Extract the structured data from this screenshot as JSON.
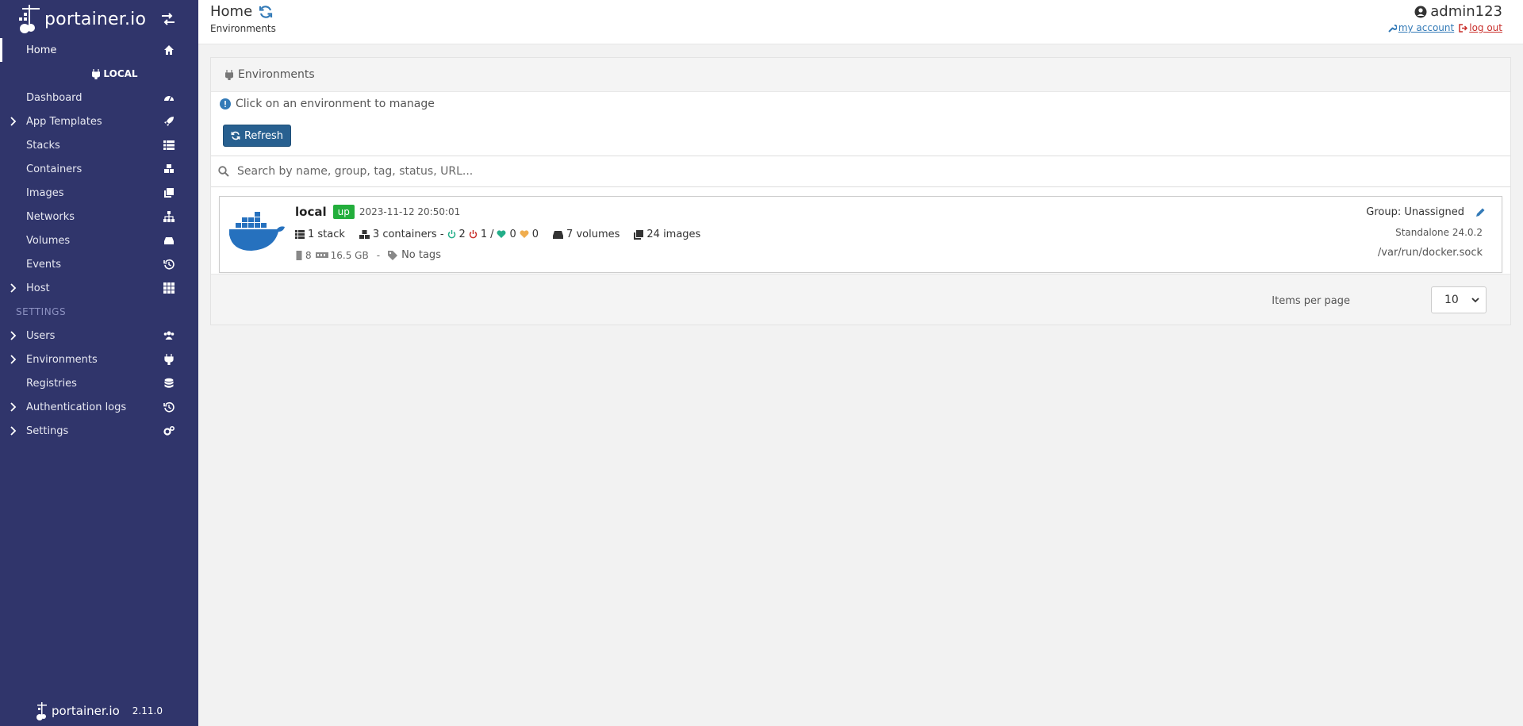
{
  "sidebar": {
    "logo_text": "portainer.io",
    "home_label": "Home",
    "env_label": "LOCAL",
    "items": [
      {
        "label": "Dashboard",
        "icon": "tachometer-icon",
        "chevron": false
      },
      {
        "label": "App Templates",
        "icon": "rocket-icon",
        "chevron": true
      },
      {
        "label": "Stacks",
        "icon": "list-icon",
        "chevron": false
      },
      {
        "label": "Containers",
        "icon": "cubes-icon",
        "chevron": false
      },
      {
        "label": "Images",
        "icon": "clone-icon",
        "chevron": false
      },
      {
        "label": "Networks",
        "icon": "sitemap-icon",
        "chevron": false
      },
      {
        "label": "Volumes",
        "icon": "hdd-icon",
        "chevron": false
      },
      {
        "label": "Events",
        "icon": "history-icon",
        "chevron": false
      },
      {
        "label": "Host",
        "icon": "th-icon",
        "chevron": true
      }
    ],
    "settings_heading": "SETTINGS",
    "settings_items": [
      {
        "label": "Users",
        "icon": "users-icon",
        "chevron": true
      },
      {
        "label": "Environments",
        "icon": "plug-icon",
        "chevron": true
      },
      {
        "label": "Registries",
        "icon": "database-icon",
        "chevron": false
      },
      {
        "label": "Authentication logs",
        "icon": "history-icon",
        "chevron": true
      },
      {
        "label": "Settings",
        "icon": "cogs-icon",
        "chevron": true
      }
    ],
    "footer_logo": "portainer.io",
    "version": "2.11.0"
  },
  "header": {
    "title": "Home",
    "breadcrumb": "Environments",
    "username": "admin123",
    "my_account": "my account",
    "log_out": "log out"
  },
  "panel": {
    "title": "Environments",
    "info": "Click on an environment to manage",
    "refresh_label": "Refresh",
    "search_placeholder": "Search by name, group, tag, status, URL..."
  },
  "environment": {
    "name": "local",
    "status": "up",
    "timestamp": "2023-11-12 20:50:01",
    "stacks": "1 stack",
    "containers": "3 containers -",
    "running": "2",
    "stopped": "1",
    "separator": "/",
    "healthy": "0",
    "unhealthy": "0",
    "volumes": "7 volumes",
    "images": "24 images",
    "cpu": "8",
    "memory": "16.5 GB",
    "dash": "-",
    "tags": "No tags",
    "group": "Group: Unassigned",
    "engine": "Standalone 24.0.2",
    "socket": "/var/run/docker.sock"
  },
  "pagination": {
    "label": "Items per page",
    "selected": "10"
  },
  "colors": {
    "sidebar_bg": "#30356b",
    "accent": "#286090",
    "status_up": "#23ae3c",
    "link": "#337ab7",
    "logout": "#c9302c"
  }
}
